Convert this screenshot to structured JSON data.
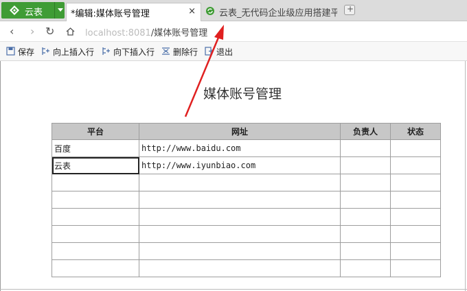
{
  "app": {
    "label": "云表"
  },
  "tabs": [
    {
      "title": "*编辑:媒体账号管理",
      "active": true
    },
    {
      "title": "云表_无代码企业级应用搭建平",
      "active": false
    }
  ],
  "newtab_label": "+",
  "close_label": "×",
  "address": {
    "host": "localhost:8081",
    "path": "/媒体账号管理"
  },
  "nav": {
    "back": "‹",
    "forward": "›",
    "reload": "↻"
  },
  "toolbar": {
    "save": "保存",
    "insert_above": "向上插入行",
    "insert_below": "向下插入行",
    "delete_row": "删除行",
    "exit": "退出"
  },
  "document": {
    "title": "媒体账号管理"
  },
  "table": {
    "headers": [
      "平台",
      "网址",
      "负责人",
      "状态"
    ],
    "rows": [
      [
        "百度",
        "http://www.baidu.com",
        "",
        ""
      ],
      [
        "云表",
        "http://www.iyunbiao.com",
        "",
        ""
      ],
      [
        "",
        "",
        "",
        ""
      ],
      [
        "",
        "",
        "",
        ""
      ],
      [
        "",
        "",
        "",
        ""
      ],
      [
        "",
        "",
        "",
        ""
      ],
      [
        "",
        "",
        "",
        ""
      ],
      [
        "",
        "",
        "",
        ""
      ]
    ]
  },
  "colors": {
    "brand": "#3f9c35",
    "arrow": "#e02020",
    "header_bg": "#c7c7c7"
  }
}
